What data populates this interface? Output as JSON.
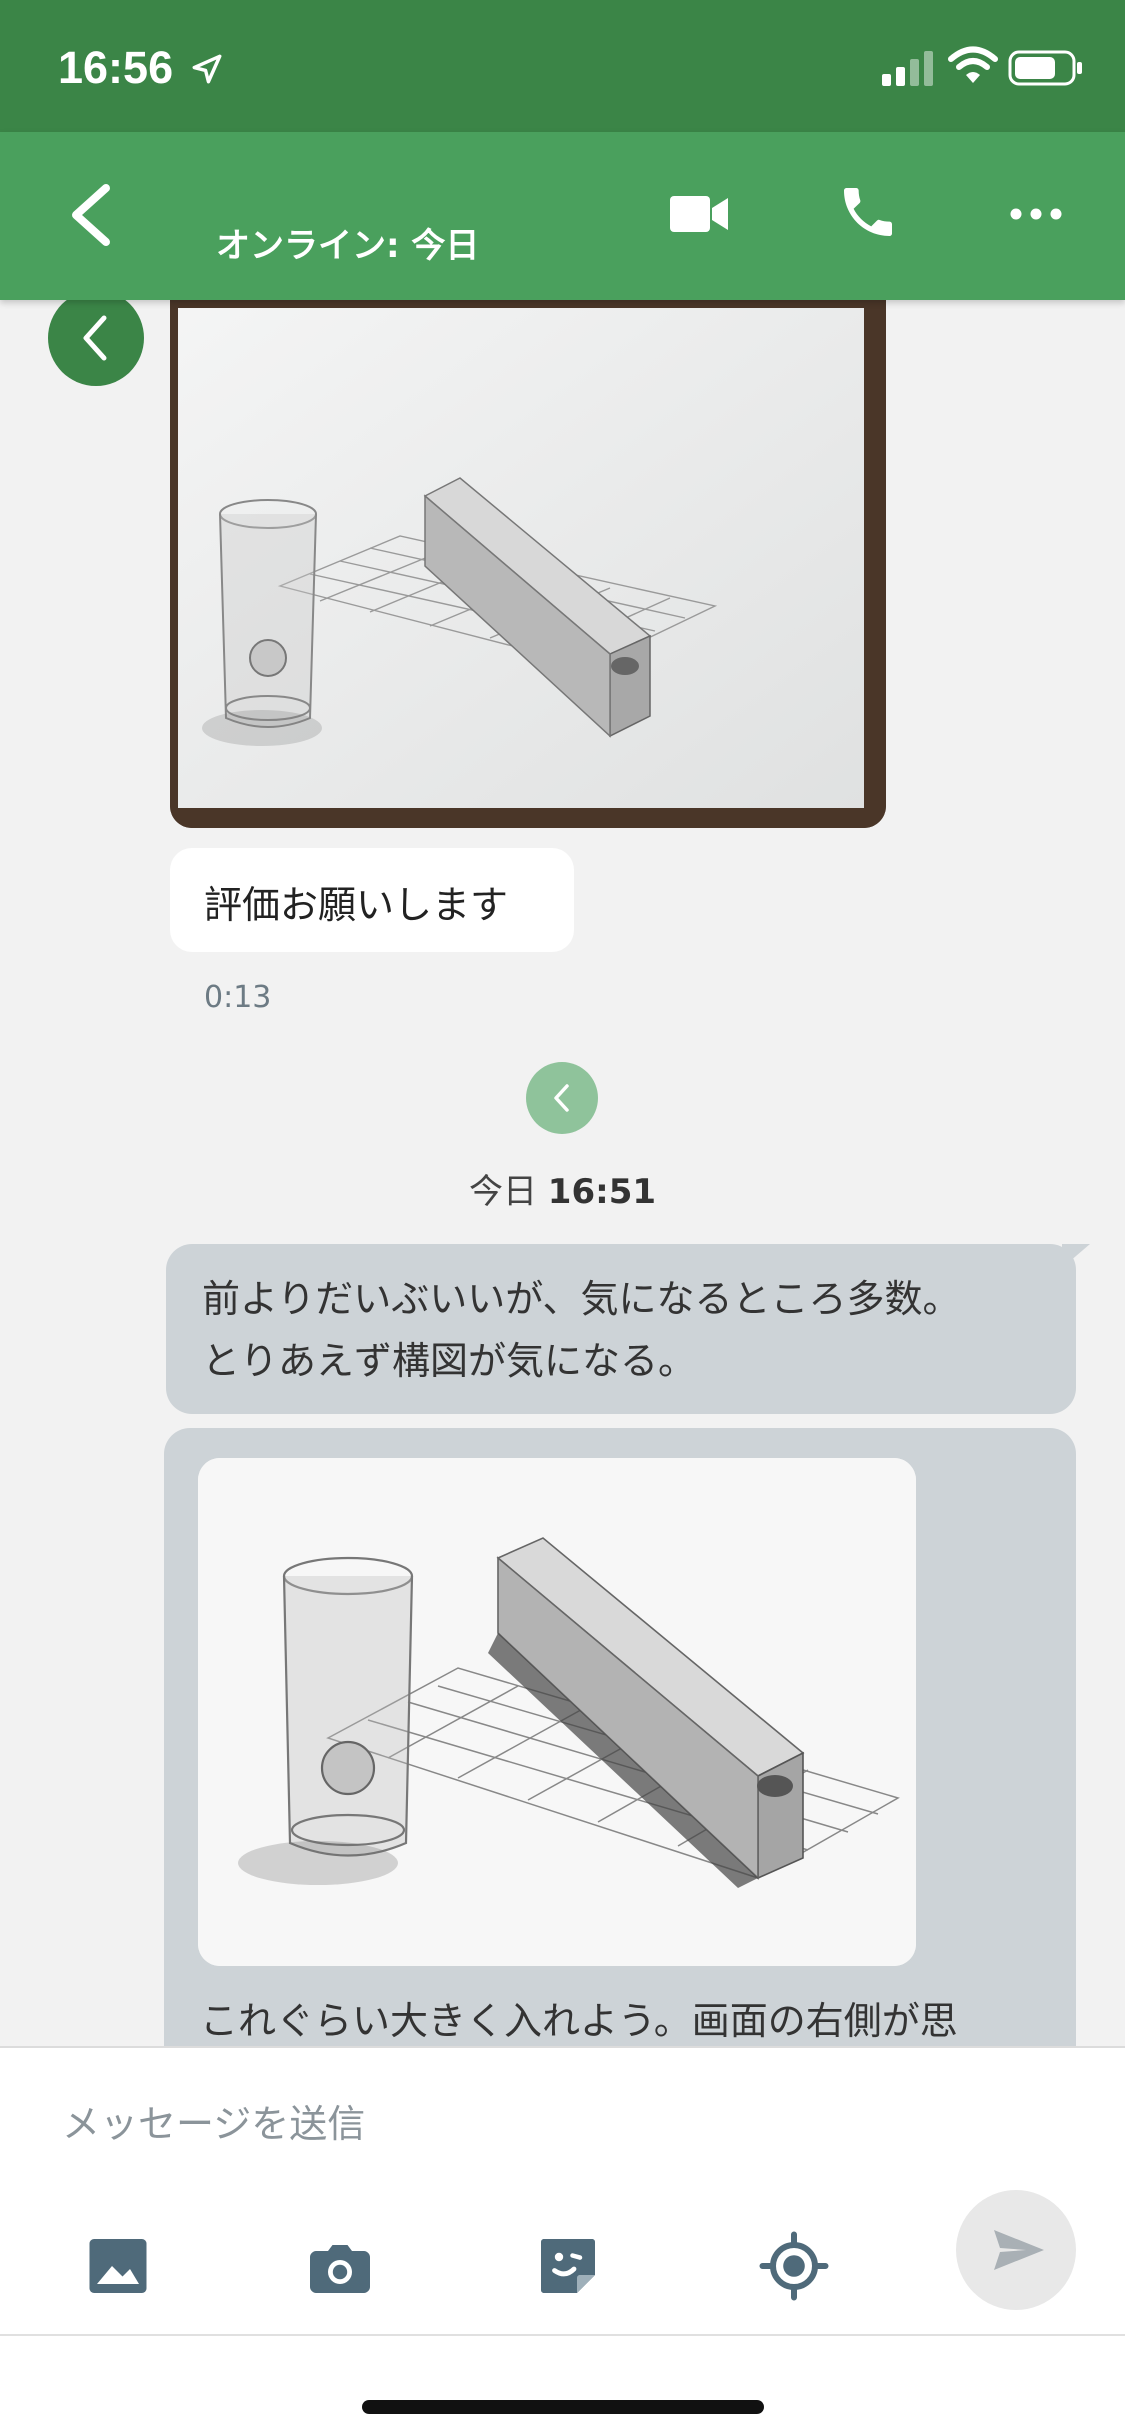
{
  "status_bar": {
    "time": "16:56",
    "icons": [
      "location-arrow-icon",
      "cellular-signal-icon",
      "wifi-icon",
      "battery-icon"
    ]
  },
  "header": {
    "status": "オンライン: 今日",
    "icons": [
      "back-arrow-icon",
      "video-call-icon",
      "phone-icon",
      "more-icon"
    ]
  },
  "messages": {
    "incoming_text": "評価お願いします",
    "incoming_time": "0:13",
    "date_label": "今日",
    "date_time": "16:51",
    "outgoing_1_line1": "前よりだいぶいいが、気になるところ多数。",
    "outgoing_1_line2": "とりあえず構図が気になる。",
    "outgoing_2_text": "これぐらい大きく入れよう。画面の右側が思"
  },
  "composer": {
    "placeholder": "メッセージを送信",
    "tools": [
      "image-icon",
      "camera-icon",
      "sticker-icon",
      "location-target-icon"
    ],
    "send_icon": "send-icon"
  },
  "colors": {
    "status_bar": "#3b8547",
    "header": "#4aa05d",
    "outgoing_bubble": "#cdd3d7",
    "incoming_bubble": "#ffffff",
    "background": "#f2f2f2"
  }
}
